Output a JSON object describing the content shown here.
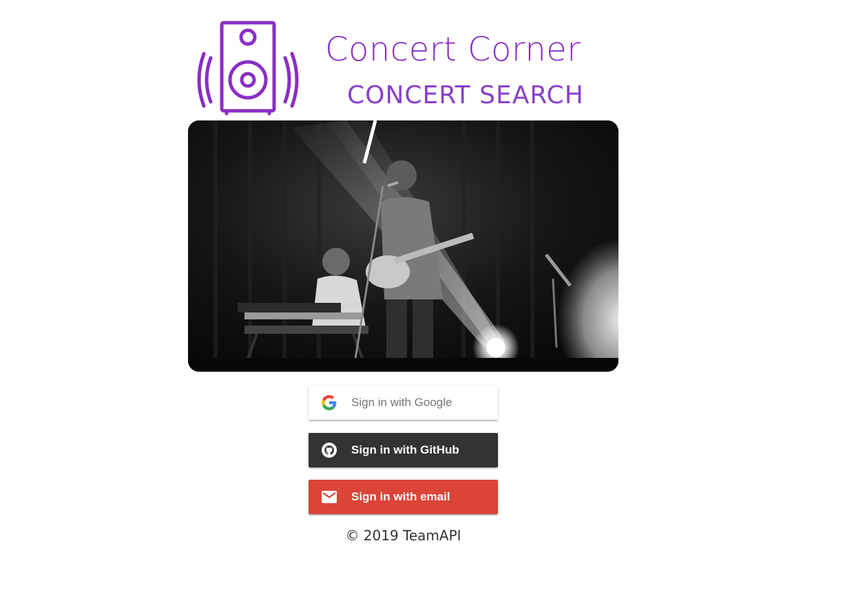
{
  "brand": {
    "title": "Concert Corner",
    "subtitle": "CONCERT SEARCH",
    "logo_icon": "speaker-icon",
    "accent_color": "#8a2fc6"
  },
  "hero": {
    "image": "concert-band-photo"
  },
  "auth": {
    "google": {
      "label": "Sign in with Google",
      "icon": "google-icon",
      "bg": "#ffffff"
    },
    "github": {
      "label": "Sign in with GitHub",
      "icon": "github-icon",
      "bg": "#333333"
    },
    "email": {
      "label": "Sign in with email",
      "icon": "mail-icon",
      "bg": "#db4437"
    }
  },
  "footer": {
    "copyright": "© 2019 TeamAPI"
  }
}
